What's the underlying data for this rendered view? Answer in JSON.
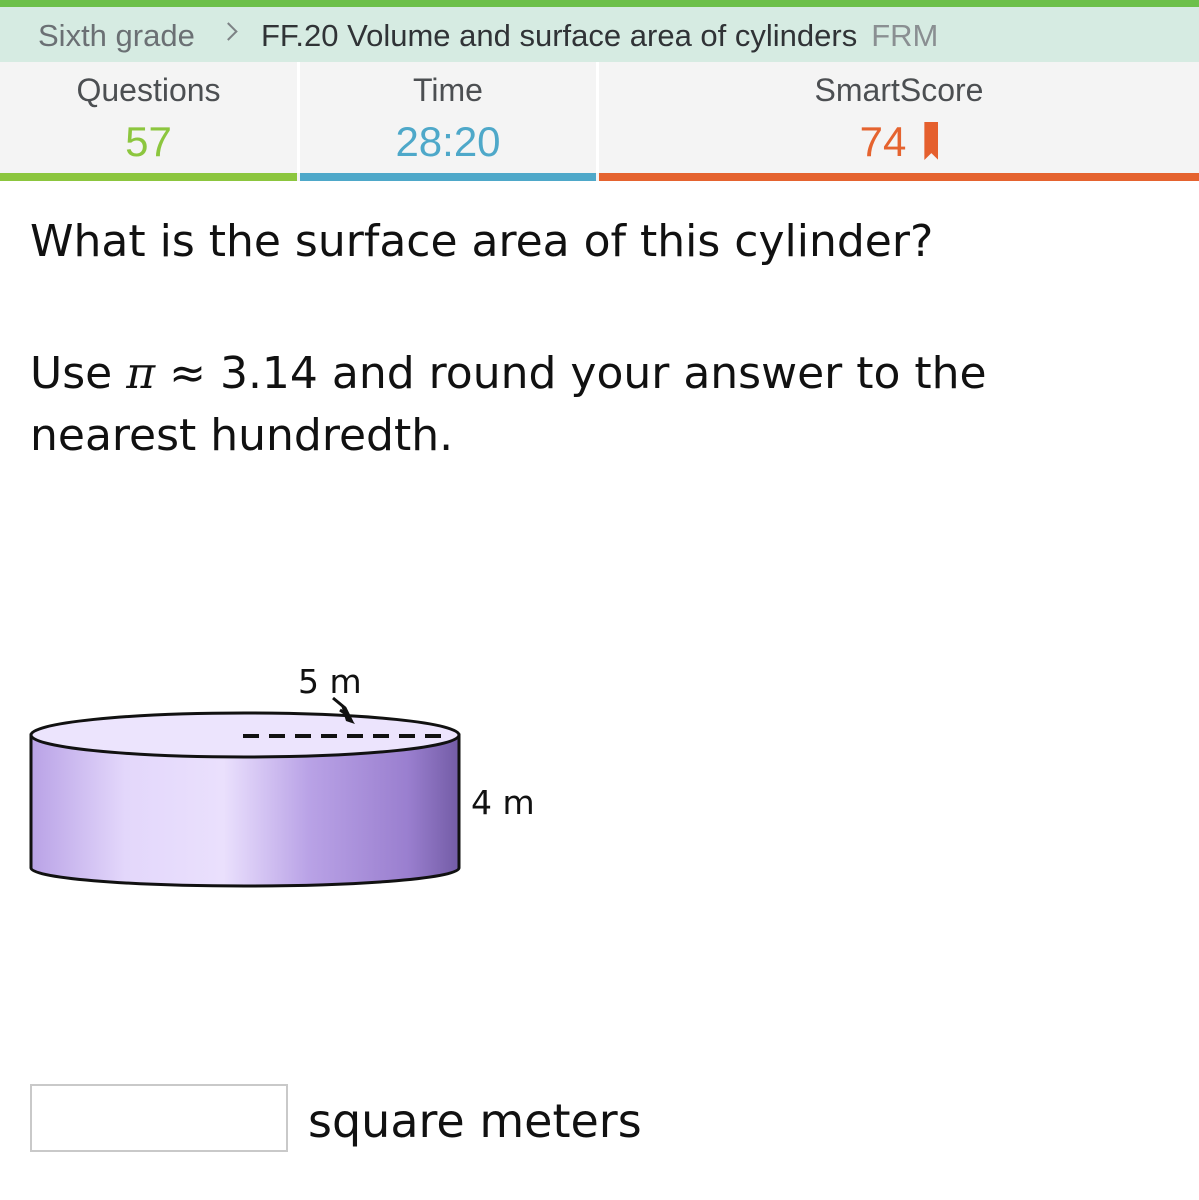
{
  "breadcrumb": {
    "grade": "Sixth grade",
    "skill": "FF.20 Volume and surface area of cylinders",
    "code": "FRM"
  },
  "stats": {
    "questions_label": "Questions",
    "questions_value": "57",
    "time_label": "Time",
    "time_value": "28:20",
    "smartscore_label": "SmartScore",
    "smartscore_value": "74"
  },
  "colors": {
    "questions": "#8cc63e",
    "time": "#4ea8c9",
    "smartscore": "#e5632f",
    "breadcrumb_bg": "#d6ebe2",
    "cylinder": "#b9a2e6"
  },
  "problem": {
    "question": "What is the surface area of this cylinder?",
    "instr_prefix": "Use ",
    "pi_symbol": "π",
    "instr_suffix": " ≈ 3.14 and round your answer to the nearest hundredth."
  },
  "figure": {
    "radius_label": "5 m",
    "height_label": "4 m"
  },
  "answer": {
    "value": "",
    "unit": "square meters"
  }
}
